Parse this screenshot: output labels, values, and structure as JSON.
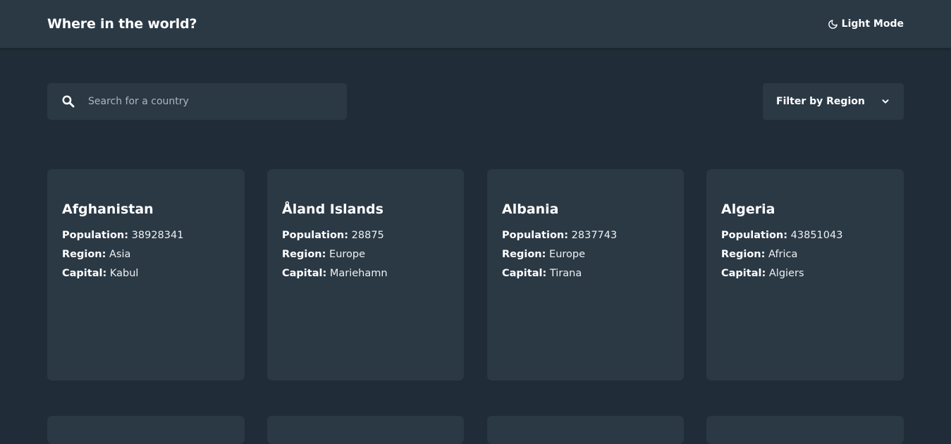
{
  "header": {
    "title": "Where in the world?",
    "mode_label": "Light Mode"
  },
  "search": {
    "placeholder": "Search for a country",
    "value": ""
  },
  "filter": {
    "label": "Filter by Region"
  },
  "labels": {
    "population": "Population:",
    "region": "Region:",
    "capital": "Capital:"
  },
  "countries": [
    {
      "name": "Afghanistan",
      "population": "38928341",
      "region": "Asia",
      "capital": "Kabul"
    },
    {
      "name": "Åland Islands",
      "population": "28875",
      "region": "Europe",
      "capital": "Mariehamn"
    },
    {
      "name": "Albania",
      "population": "2837743",
      "region": "Europe",
      "capital": "Tirana"
    },
    {
      "name": "Algeria",
      "population": "43851043",
      "region": "Africa",
      "capital": "Algiers"
    }
  ],
  "colors": {
    "background": "#202c37",
    "element": "#2b3945",
    "text": "#ffffff",
    "placeholder": "#aeb6bd"
  },
  "icons": {
    "mode": "moon-icon",
    "search": "search-icon",
    "filter": "chevron-down-icon"
  }
}
